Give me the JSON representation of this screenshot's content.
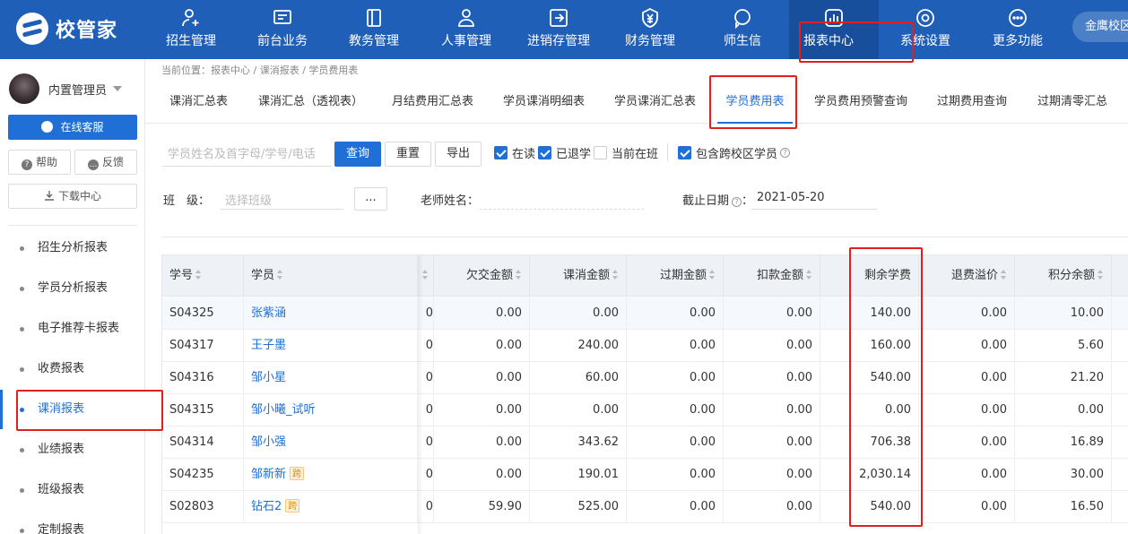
{
  "app": {
    "logo_text": "校管家",
    "campus": "金鹰校区"
  },
  "nav": [
    {
      "label": "招生管理",
      "icon": "add-user-icon"
    },
    {
      "label": "前台业务",
      "icon": "monitor-icon"
    },
    {
      "label": "教务管理",
      "icon": "book-icon"
    },
    {
      "label": "人事管理",
      "icon": "person-icon"
    },
    {
      "label": "进销存管理",
      "icon": "box-arrow-icon"
    },
    {
      "label": "财务管理",
      "icon": "yen-shield-icon"
    },
    {
      "label": "师生信",
      "icon": "chat-icon"
    },
    {
      "label": "报表中心",
      "icon": "bar-chart-icon",
      "active": true
    },
    {
      "label": "系统设置",
      "icon": "settings-icon"
    },
    {
      "label": "更多功能",
      "icon": "more-icon"
    }
  ],
  "sidebar": {
    "admin_name": "内置管理员",
    "service_label": "在线客服",
    "help_label": "帮助",
    "feedback_label": "反馈",
    "download_label": "下载中心",
    "items": [
      {
        "label": "招生分析报表"
      },
      {
        "label": "学员分析报表"
      },
      {
        "label": "电子推荐卡报表"
      },
      {
        "label": "收费报表"
      },
      {
        "label": "课消报表",
        "active": true
      },
      {
        "label": "业绩报表"
      },
      {
        "label": "班级报表"
      },
      {
        "label": "定制报表"
      }
    ]
  },
  "breadcrumb": "当前位置：报表中心 / 课消报表 / 学员费用表",
  "tabs": [
    {
      "label": "课消汇总表"
    },
    {
      "label": "课消汇总（透视表）"
    },
    {
      "label": "月结费用汇总表"
    },
    {
      "label": "学员课消明细表"
    },
    {
      "label": "学员课消汇总表"
    },
    {
      "label": "学员费用表",
      "active": true
    },
    {
      "label": "学员费用预警查询"
    },
    {
      "label": "过期费用查询"
    },
    {
      "label": "过期清零汇总"
    }
  ],
  "filters": {
    "search_placeholder": "学员姓名及首字母/学号/电话",
    "query_label": "查询",
    "reset_label": "重置",
    "export_label": "导出",
    "checkboxes": [
      {
        "label": "在读",
        "checked": true
      },
      {
        "label": "已退学",
        "checked": true
      },
      {
        "label": "当前在班",
        "checked": false
      },
      {
        "label": "包含跨校区学员",
        "checked": true
      }
    ],
    "class_label": "班　级：",
    "class_placeholder": "选择班级",
    "class_btn": "...",
    "teacher_label": "老师姓名：",
    "cutoff_label": "截止日期",
    "cutoff_colon": "：",
    "cutoff_value": "2021-05-20"
  },
  "table": {
    "headers": [
      "学号",
      "学员",
      "欠交金额",
      "课消金额",
      "过期金额",
      "扣款金额",
      "剩余学费",
      "退费溢价",
      "积分余额"
    ],
    "partial_col_text": "0",
    "rows": [
      {
        "id": "S04325",
        "name": "张紫涵",
        "kua": false,
        "owed": "0.00",
        "consumed": "0.00",
        "expired": "0.00",
        "deducted": "0.00",
        "remaining": "140.00",
        "refund": "0.00",
        "points": "10.00"
      },
      {
        "id": "S04317",
        "name": "王子墨",
        "kua": false,
        "owed": "0.00",
        "consumed": "240.00",
        "expired": "0.00",
        "deducted": "0.00",
        "remaining": "160.00",
        "refund": "0.00",
        "points": "5.60"
      },
      {
        "id": "S04316",
        "name": "邹小星",
        "kua": false,
        "owed": "0.00",
        "consumed": "60.00",
        "expired": "0.00",
        "deducted": "0.00",
        "remaining": "540.00",
        "refund": "0.00",
        "points": "21.20"
      },
      {
        "id": "S04315",
        "name": "邹小曦_试听",
        "kua": false,
        "owed": "0.00",
        "consumed": "0.00",
        "expired": "0.00",
        "deducted": "0.00",
        "remaining": "0.00",
        "refund": "0.00",
        "points": "0.00"
      },
      {
        "id": "S04314",
        "name": "邹小强",
        "kua": false,
        "owed": "0.00",
        "consumed": "343.62",
        "expired": "0.00",
        "deducted": "0.00",
        "remaining": "706.38",
        "refund": "0.00",
        "points": "16.89"
      },
      {
        "id": "S04235",
        "name": "邹新新",
        "kua": true,
        "owed": "0.00",
        "consumed": "190.01",
        "expired": "0.00",
        "deducted": "0.00",
        "remaining": "2,030.14",
        "refund": "0.00",
        "points": "30.00"
      },
      {
        "id": "S02803",
        "name": "钻石2",
        "kua": true,
        "owed": "59.90",
        "consumed": "525.00",
        "expired": "0.00",
        "deducted": "0.00",
        "remaining": "540.00",
        "refund": "0.00",
        "points": "16.50"
      }
    ],
    "kua_label": "跨"
  },
  "colors": {
    "brand": "#1f5fb8",
    "primary": "#1f6fd6",
    "annotation": "#e0201f"
  }
}
